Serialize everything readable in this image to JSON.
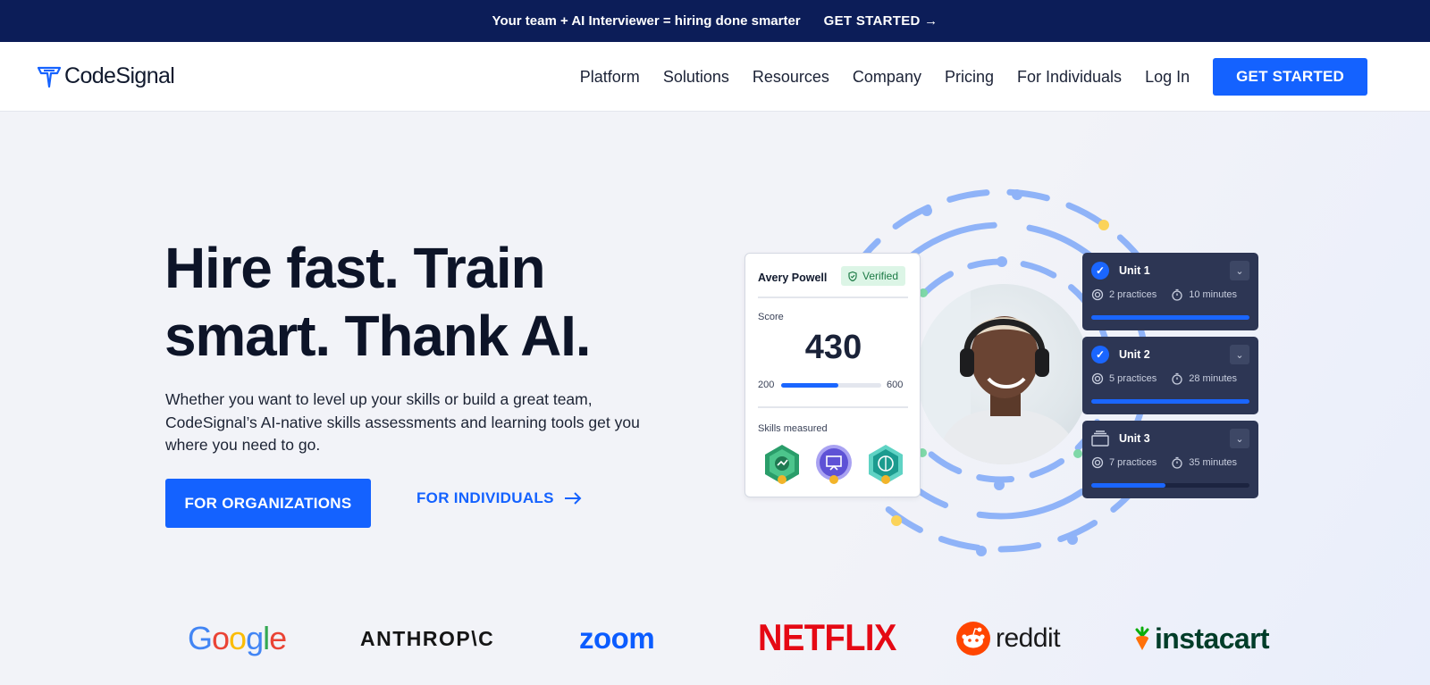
{
  "announcement": {
    "message": "Your team + AI Interviewer = hiring done smarter",
    "cta": "GET STARTED →"
  },
  "nav": {
    "logo_text": "CodeSignal",
    "links": [
      "Platform",
      "Solutions",
      "Resources",
      "Company",
      "Pricing",
      "For Individuals",
      "Log In"
    ],
    "cta": "GET STARTED"
  },
  "hero": {
    "title_line1": "Hire fast. Train",
    "title_line2": "smart. Thank AI.",
    "subtitle": "Whether you want to level up your skills or build a great team, CodeSignal’s AI-native skills assessments and learning tools get you where you need to go.",
    "primary_cta": "FOR ORGANIZATIONS",
    "secondary_cta": "FOR INDIVIDUALS",
    "secondary_cta_icon": "arrow-right-icon"
  },
  "score_card": {
    "name": "Avery Powell",
    "verified_label": "Verified",
    "score_label": "Score",
    "score": "430",
    "range_min": "200",
    "range_max": "600",
    "score_value": 430,
    "skills_label": "Skills measured",
    "skill_badges": [
      "analytics-badge-icon",
      "presentation-badge-icon",
      "brain-badge-icon"
    ]
  },
  "units": [
    {
      "title": "Unit 1",
      "practices": "2 practices",
      "duration": "10 minutes",
      "completed": true,
      "progress": 1.0
    },
    {
      "title": "Unit 2",
      "practices": "5 practices",
      "duration": "28 minutes",
      "completed": true,
      "progress": 1.0
    },
    {
      "title": "Unit 3",
      "practices": "7 practices",
      "duration": "35 minutes",
      "completed": false,
      "progress": 0.47
    }
  ],
  "logos": {
    "google": "Google",
    "anthropic": "ANTHROP\\C",
    "zoom": "zoom",
    "netflix": "NETFLIX",
    "reddit": "reddit",
    "instacart": "instacart"
  },
  "colors": {
    "announcement_bg": "#0c1d58",
    "accent": "#1462ff",
    "unit_card_bg": "#2d3654",
    "ring": "#8fb3f8",
    "netflix": "#e50914",
    "zoom": "#0b5cff",
    "instacart": "#003d29",
    "reddit": "#ff4500"
  }
}
